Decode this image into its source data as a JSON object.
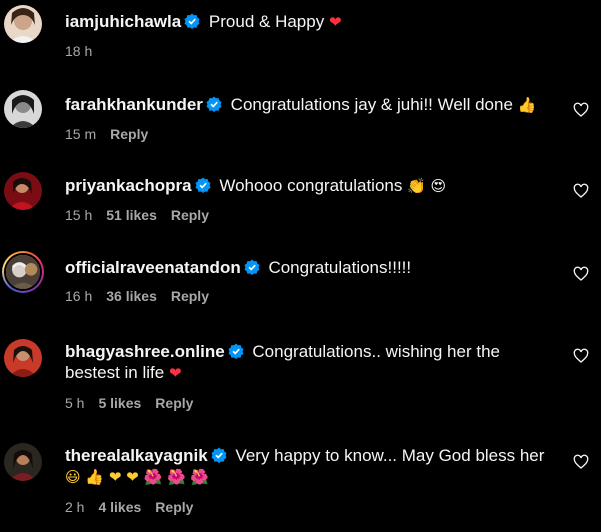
{
  "comments": [
    {
      "username": "iamjuhichawla",
      "text": "Proud & Happy",
      "emoji": "❤",
      "time": "18 h",
      "likes": "",
      "reply": ""
    },
    {
      "username": "farahkhankunder",
      "text": "Congratulations jay & juhi!! Well done",
      "emoji": "👍",
      "time": "15 m",
      "likes": "",
      "reply": "Reply"
    },
    {
      "username": "priyankachopra",
      "text": "Wohooo congratulations",
      "emoji": "👏 😍",
      "time": "15 h",
      "likes": "51 likes",
      "reply": "Reply"
    },
    {
      "username": "officialraveenatandon",
      "text": "Congratulations!!!!!",
      "emoji": "",
      "time": "16 h",
      "likes": "36 likes",
      "reply": "Reply"
    },
    {
      "username": "bhagyashree.online",
      "text": "Congratulations.. wishing her the bestest in life",
      "emoji": "❤",
      "time": "5 h",
      "likes": "5 likes",
      "reply": "Reply"
    },
    {
      "username": "therealalkayagnik",
      "text": "Very happy to know... May God bless her",
      "emoji": "😃 👍 ❤ ❤ 🌺 🌺 🌺",
      "time": "2 h",
      "likes": "4 likes",
      "reply": "Reply"
    }
  ],
  "colors": {
    "background": "#000000",
    "text": "#f5f5f5",
    "meta": "#a8a8a8",
    "verified": "#0095f6",
    "heart": "#ff3040"
  }
}
